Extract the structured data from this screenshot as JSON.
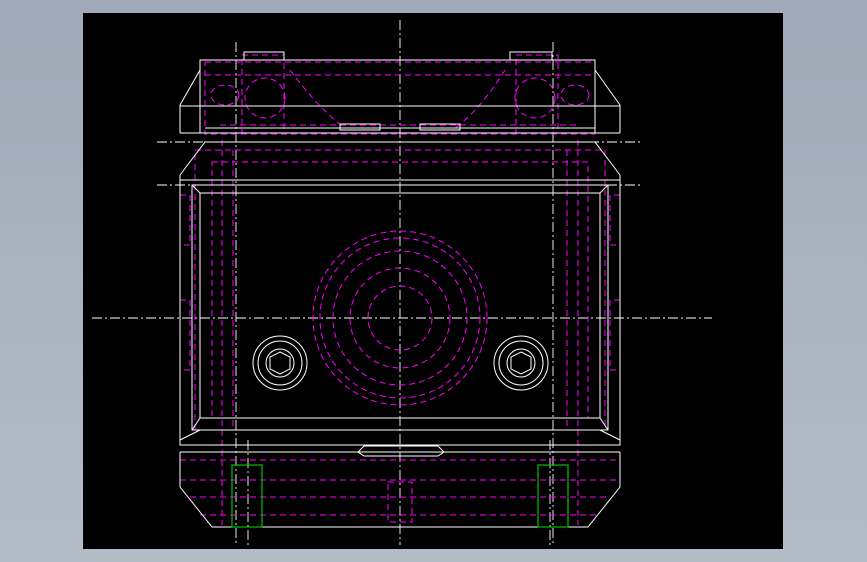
{
  "colors": {
    "page_background": "#a9b2bf",
    "viewport_background": "#000000",
    "outline": "#ffffff",
    "hidden_lines": "#ff00ff",
    "centerlines": "#ffffff",
    "insert_lines": "#00c000"
  },
  "drawing": {
    "view": "front",
    "line_types": [
      "visible",
      "hidden-dashed",
      "center-dashdot"
    ],
    "features": [
      "housing-outline",
      "top-cover",
      "bottom-rail",
      "central-bore",
      "hex-socket-screw-left",
      "hex-socket-screw-right",
      "insert-left",
      "insert-right"
    ]
  }
}
